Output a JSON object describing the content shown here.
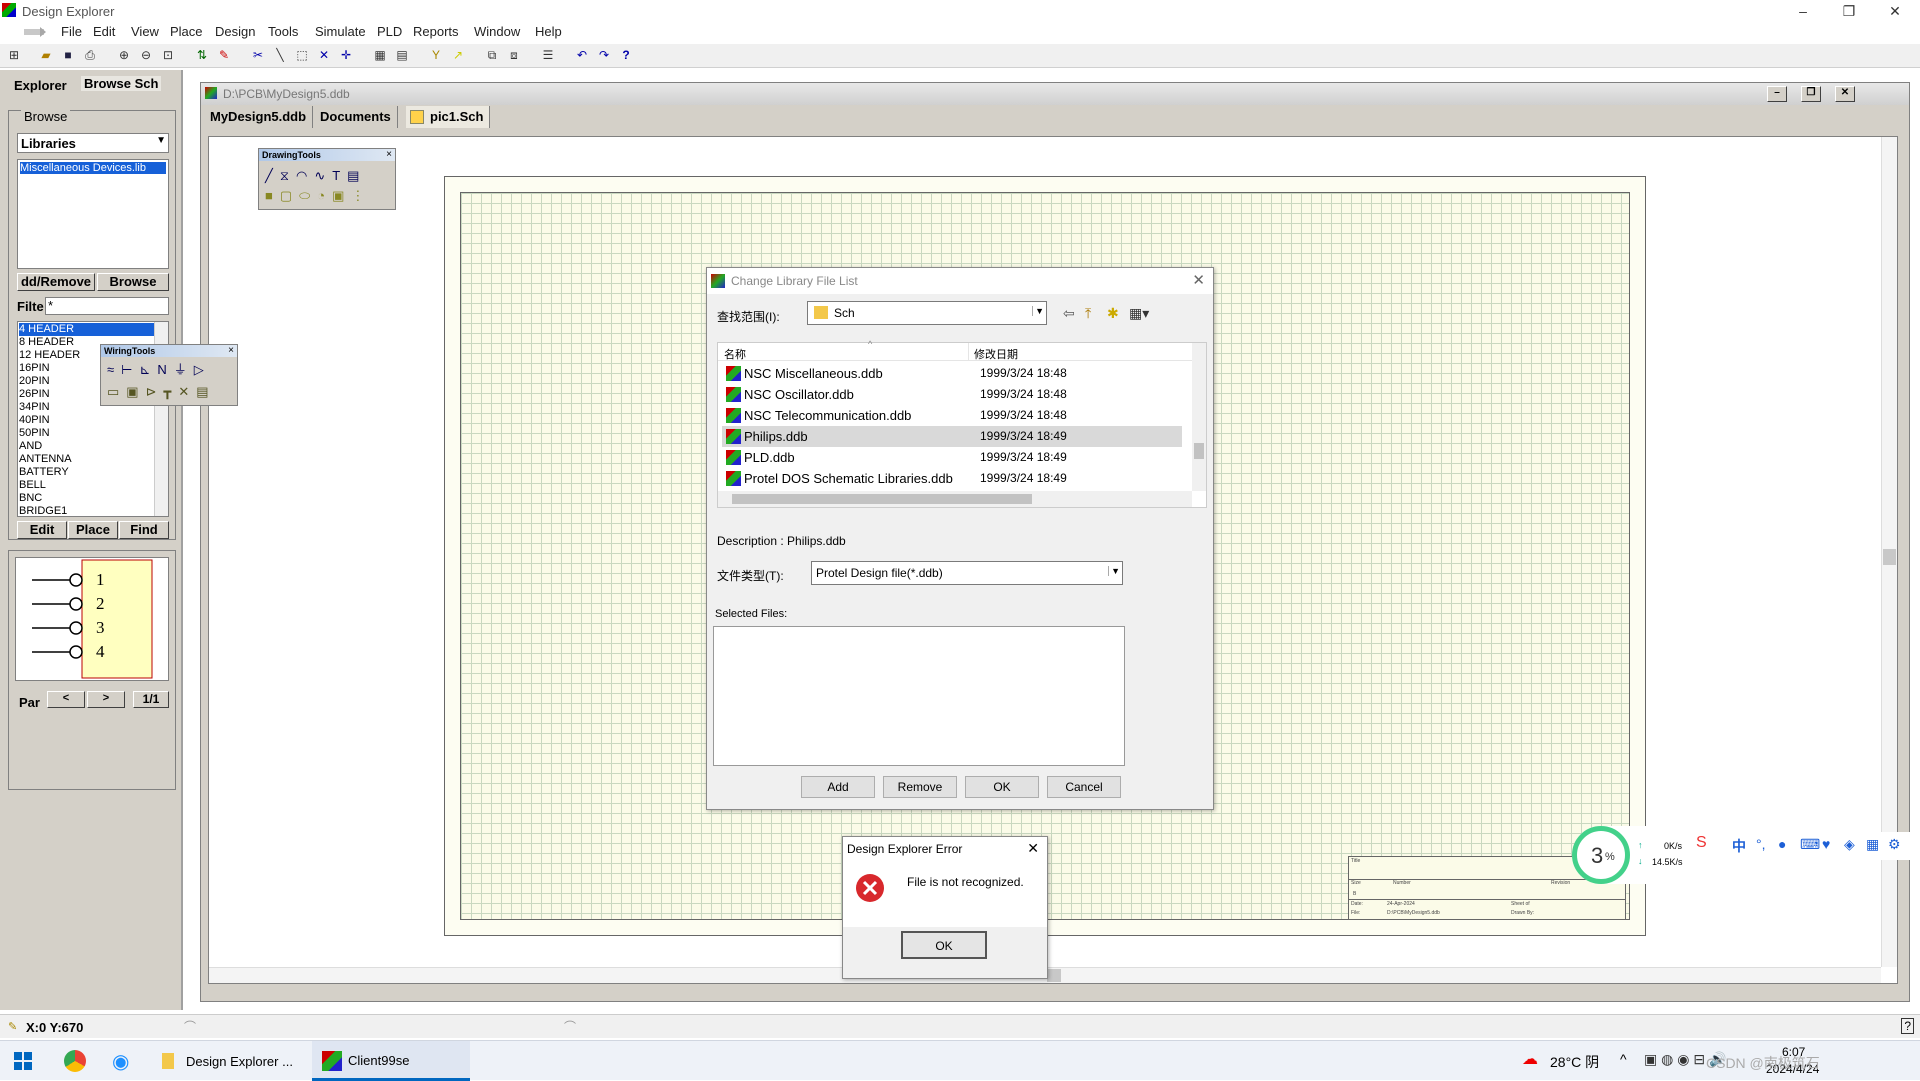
{
  "window": {
    "title": "Design Explorer",
    "minimize": "–",
    "restore": "❐",
    "close": "✕"
  },
  "menu": [
    "File",
    "Edit",
    "View",
    "Place",
    "Design",
    "Tools",
    "Simulate",
    "PLD",
    "Reports",
    "Window",
    "Help"
  ],
  "toolbar_icons": [
    "tree-icon",
    "open-icon",
    "save-icon",
    "print-icon",
    "zoom-in-icon",
    "zoom-out-icon",
    "zoom-fit-icon",
    "updown-icon",
    "pencil-icon",
    "cut-icon",
    "wire-icon",
    "select-icon",
    "deselect-icon",
    "move-icon",
    "library-icon",
    "library2-icon",
    "probe-icon",
    "arrow-icon",
    "hierarchy-icon",
    "hierarchy2-icon",
    "list-icon",
    "undo-icon",
    "redo-icon",
    "help-icon"
  ],
  "left_panel": {
    "tabs": [
      "Explorer",
      "Browse Sch"
    ],
    "browse_label": "Browse",
    "browse_select": "Libraries",
    "library_list": [
      "Miscellaneous Devices.lib"
    ],
    "add_remove": "dd/Remove",
    "browse_button": "Browse",
    "filter_label": "Filte",
    "filter_value": "*",
    "components": [
      "4 HEADER",
      "8 HEADER",
      "12 HEADER",
      "16PIN",
      "20PIN",
      "26PIN",
      "34PIN",
      "40PIN",
      "50PIN",
      "AND",
      "ANTENNA",
      "BATTERY",
      "BELL",
      "BNC",
      "BRIDGE1"
    ],
    "edit": "Edit",
    "place": "Place",
    "find": "Find",
    "preview_pins": [
      "1",
      "2",
      "3",
      "4"
    ],
    "part_label": "Par",
    "part_prev": "<",
    "part_next": ">",
    "part_count": "1/1"
  },
  "document": {
    "path": "D:\\PCB\\MyDesign5.ddb",
    "tabs": [
      "MyDesign5.ddb",
      "Documents",
      "pic1.Sch"
    ],
    "buttons": [
      "–",
      "❐",
      "✕"
    ]
  },
  "drawing_tools": {
    "title": "DrawingTools"
  },
  "wiring_tools": {
    "title": "WiringTools"
  },
  "library_dialog": {
    "title": "Change Library File List",
    "lookin_label": "查找范围(I):",
    "lookin_value": "Sch",
    "col_name": "名称",
    "col_date": "修改日期",
    "files": [
      {
        "name": "NSC Miscellaneous.ddb",
        "date": "1999/3/24 18:48"
      },
      {
        "name": "NSC Oscillator.ddb",
        "date": "1999/3/24 18:48"
      },
      {
        "name": "NSC Telecommunication.ddb",
        "date": "1999/3/24 18:48"
      },
      {
        "name": "Philips.ddb",
        "date": "1999/3/24 18:49"
      },
      {
        "name": "PLD.ddb",
        "date": "1999/3/24 18:49"
      },
      {
        "name": "Protel DOS Schematic Libraries.ddb",
        "date": "1999/3/24 18:49"
      }
    ],
    "description": "Description : Philips.ddb",
    "filetype_label": "文件类型(T):",
    "filetype_value": "Protel Design file(*.ddb)",
    "selected_label": "Selected Files:",
    "add": "Add",
    "remove": "Remove",
    "ok": "OK",
    "cancel": "Cancel"
  },
  "error_dialog": {
    "title": "Design Explorer Error",
    "message": "File is not recognized.",
    "ok": "OK"
  },
  "net_widget": {
    "percent": "3",
    "percent_unit": "%",
    "up": "0K/s",
    "down": "14.5K/s"
  },
  "ime_bar": {
    "lang": "中"
  },
  "title_block": {
    "title": "Title",
    "size": "Size",
    "number": "Number",
    "revision": "Revision",
    "size_value": "B",
    "date_label": "Date:",
    "date_value": "24-Apr-2024",
    "sheet_of": "Sheet of",
    "file_label": "File:",
    "file_value": "D:\\PCB\\MyDesign5.ddb",
    "drawn_by": "Drawn By:"
  },
  "status": {
    "coords": "X:0 Y:670"
  },
  "taskbar": {
    "items": [
      "Design Explorer ...",
      "Client99se"
    ],
    "weather": "28°C 阴",
    "time": "6:07",
    "date": "2024/4/24",
    "watermark": "CSDN @南极筑石"
  }
}
